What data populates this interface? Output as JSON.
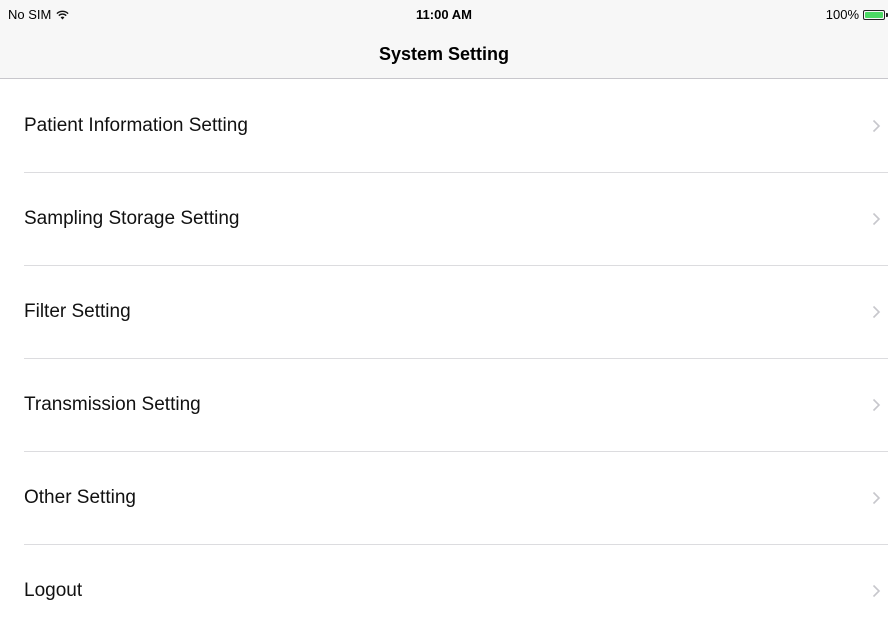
{
  "status_bar": {
    "carrier": "No SIM",
    "wifi_icon": "wifi-icon",
    "time": "11:00 AM",
    "battery_percent": "100%",
    "battery_level": 1.0,
    "battery_color": "#4cd964"
  },
  "nav": {
    "title": "System Setting"
  },
  "settings": {
    "items": [
      {
        "label": "Patient Information Setting",
        "icon": "chevron-right-icon"
      },
      {
        "label": "Sampling Storage Setting",
        "icon": "chevron-right-icon"
      },
      {
        "label": "Filter Setting",
        "icon": "chevron-right-icon"
      },
      {
        "label": "Transmission Setting",
        "icon": "chevron-right-icon"
      },
      {
        "label": "Other Setting",
        "icon": "chevron-right-icon"
      },
      {
        "label": "Logout",
        "icon": "chevron-right-icon"
      }
    ]
  }
}
